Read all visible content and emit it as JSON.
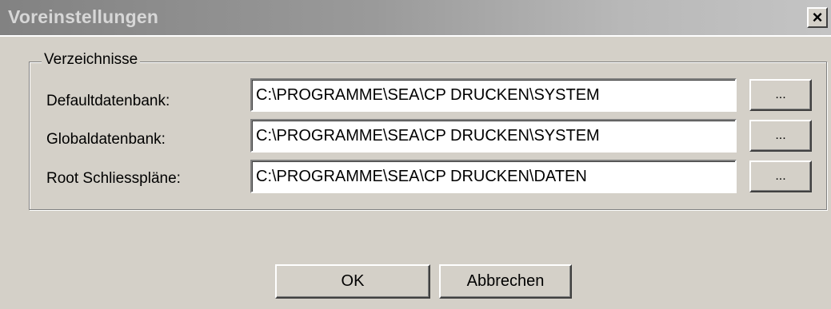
{
  "window": {
    "title": "Voreinstellungen",
    "close_label": "×"
  },
  "group": {
    "legend": "Verzeichnisse",
    "rows": [
      {
        "label": "Defaultdatenbank:",
        "value": "C:\\PROGRAMME\\SEA\\CP DRUCKEN\\SYSTEM",
        "browse_label": "..."
      },
      {
        "label": "Globaldatenbank:",
        "value": "C:\\PROGRAMME\\SEA\\CP DRUCKEN\\SYSTEM",
        "browse_label": "..."
      },
      {
        "label": "Root Schliesspläne:",
        "value": "C:\\PROGRAMME\\SEA\\CP DRUCKEN\\DATEN",
        "browse_label": "..."
      }
    ]
  },
  "buttons": {
    "ok_label": "OK",
    "cancel_label": "Abbrechen"
  },
  "icons": {
    "close": "close-icon"
  },
  "colors": {
    "dialog_face": "#d4d0c8",
    "titlebar_inactive": "#9a9a9a",
    "field_background": "#ffffff"
  }
}
